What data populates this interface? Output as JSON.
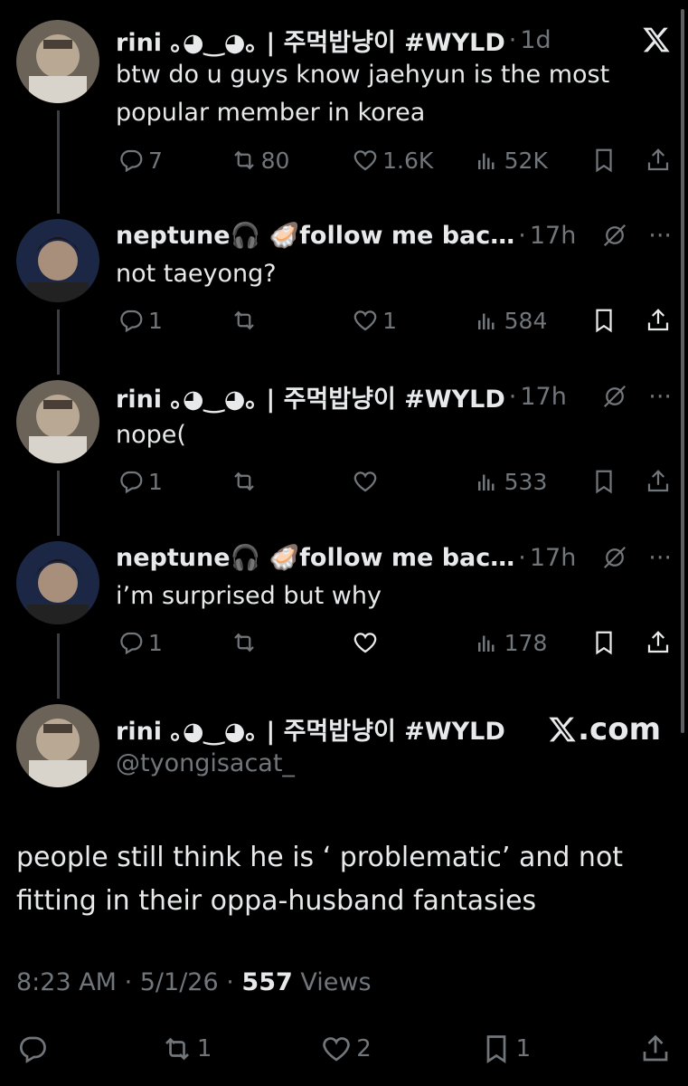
{
  "colors": {
    "background": "#000000",
    "text": "#e7e9ea",
    "muted": "#71767b",
    "thread": "#3a3d41"
  },
  "tweets": [
    {
      "name": "rini ｡◕‿◕｡ | 주먹밥냥이 #WYLD",
      "time": "1d",
      "text": "btw do u guys know jaehyun is the most popular member in korea",
      "replies": "7",
      "retweets": "80",
      "likes": "1.6K",
      "views": "52K"
    },
    {
      "name": "neptune🎧 🦪follow me bac…",
      "time": "17h",
      "text": "not taeyong?",
      "replies": "1",
      "retweets": "",
      "likes": "1",
      "views": "584"
    },
    {
      "name": "rini ｡◕‿◕｡ | 주먹밥냥이 #WYLD",
      "time": "17h",
      "text": "nope(",
      "replies": "1",
      "retweets": "",
      "likes": "",
      "views": "533"
    },
    {
      "name": "neptune🎧 🦪follow me bac…",
      "time": "17h",
      "text": "i’m surprised but why",
      "replies": "1",
      "retweets": "",
      "likes": "",
      "views": "178"
    }
  ],
  "main": {
    "name": "rini ｡◕‿◕｡ | 주먹밥냥이 #WYLD",
    "handle": "@tyongisacat_",
    "site": ".com",
    "text": "people still think he is ‘ problematic’ and not fitting in their oppa-husband fantasies",
    "time": "8:23 AM",
    "date": "5/1/26",
    "views_count": "557",
    "views_label": "Views",
    "replies": "",
    "retweets": "1",
    "likes": "2",
    "bookmarks": "1"
  },
  "icons": [
    "x-logo-icon",
    "reply-icon",
    "retweet-icon",
    "like-icon",
    "views-icon",
    "bookmark-icon",
    "share-icon",
    "grok-icon",
    "more-icon"
  ]
}
